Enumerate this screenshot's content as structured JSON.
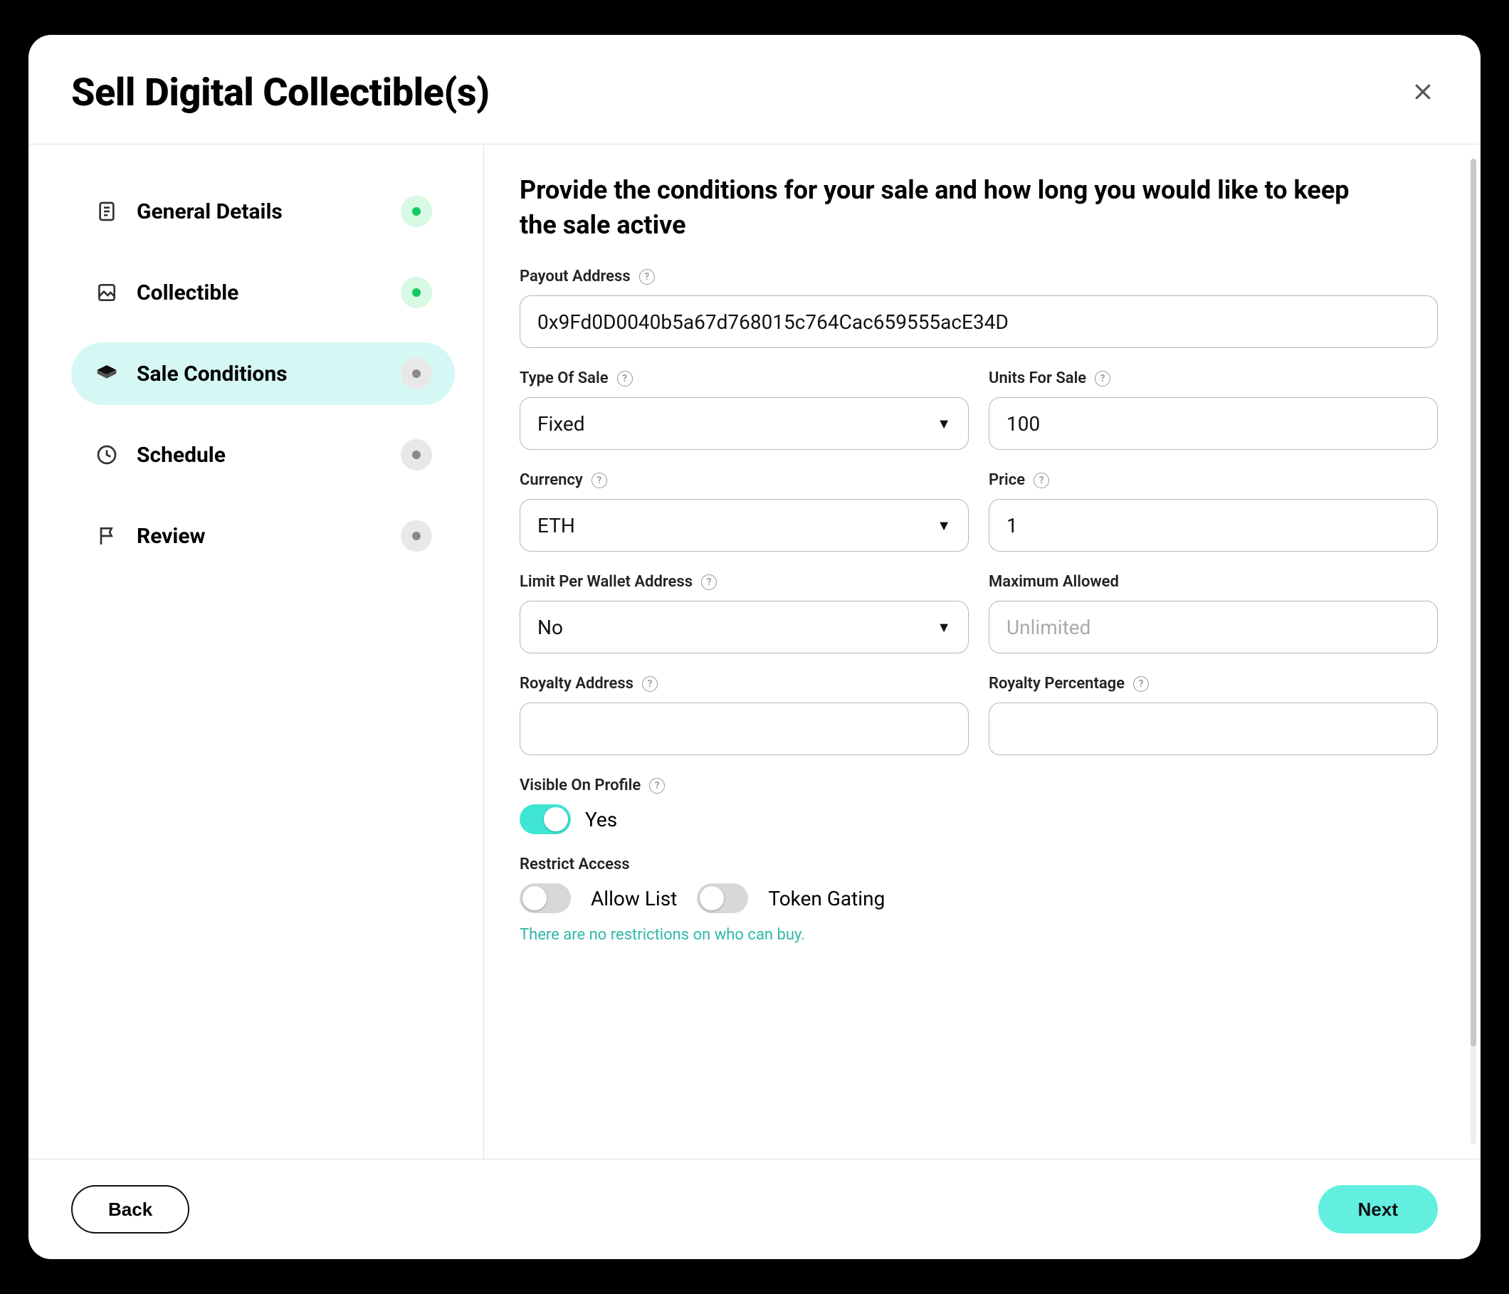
{
  "header": {
    "title": "Sell Digital Collectible(s)"
  },
  "sidebar": {
    "steps": [
      {
        "label": "General Details",
        "status": "done",
        "icon": "doc"
      },
      {
        "label": "Collectible",
        "status": "done",
        "icon": "image"
      },
      {
        "label": "Sale Conditions",
        "status": "pending",
        "icon": "layers",
        "active": true
      },
      {
        "label": "Schedule",
        "status": "pending",
        "icon": "clock"
      },
      {
        "label": "Review",
        "status": "pending",
        "icon": "flag"
      }
    ]
  },
  "main": {
    "heading": "Provide the conditions for your sale and how long you would like to keep the sale active",
    "payout_label": "Payout Address",
    "payout_value": "0x9Fd0D0040b5a67d768015c764Cac659555acE34D",
    "type_of_sale_label": "Type Of Sale",
    "type_of_sale_value": "Fixed",
    "units_label": "Units For Sale",
    "units_value": "100",
    "currency_label": "Currency",
    "currency_value": "ETH",
    "price_label": "Price",
    "price_value": "1",
    "limit_label": "Limit Per Wallet Address",
    "limit_value": "No",
    "max_label": "Maximum Allowed",
    "max_placeholder": "Unlimited",
    "royalty_addr_label": "Royalty Address",
    "royalty_addr_value": "",
    "royalty_pct_label": "Royalty Percentage",
    "royalty_pct_value": "",
    "visible_label": "Visible On Profile",
    "visible_value_label": "Yes",
    "restrict_label": "Restrict Access",
    "allow_list_label": "Allow List",
    "token_gating_label": "Token Gating",
    "restrict_hint": "There are no restrictions on who can buy."
  },
  "footer": {
    "back": "Back",
    "next": "Next"
  }
}
